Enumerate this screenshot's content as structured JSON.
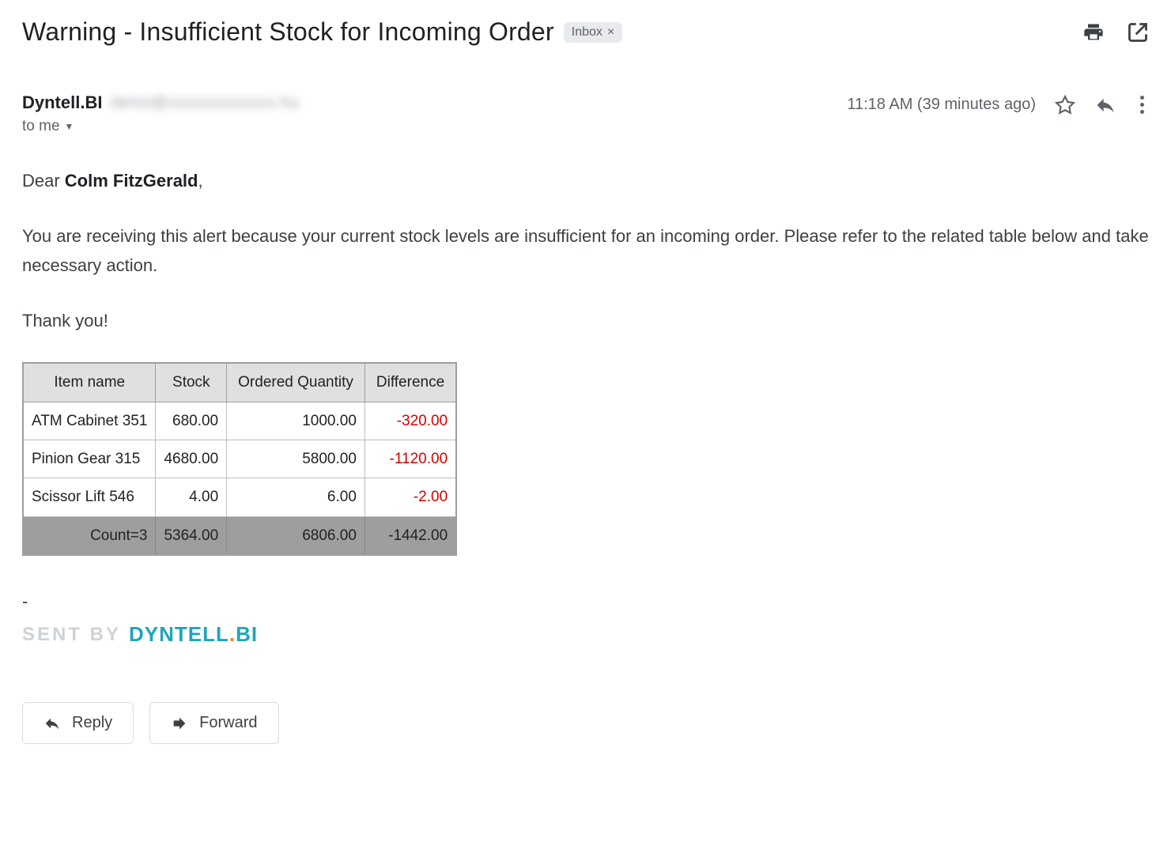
{
  "header": {
    "subject": "Warning - Insufficient Stock for Incoming Order",
    "inbox_label": "Inbox",
    "inbox_x": "×"
  },
  "sender": {
    "name": "Dyntell.BI",
    "to_label": "to me",
    "time": "11:18 AM (39 minutes ago)"
  },
  "body": {
    "greeting_prefix": "Dear ",
    "greeting_name": "Colm FitzGerald",
    "greeting_suffix": ",",
    "paragraph": "You are receiving this alert because your current stock levels are insufficient for an incoming order. Please refer to the related table below and take necessary action.",
    "thanks": "Thank you!"
  },
  "table": {
    "headers": [
      "Item name",
      "Stock",
      "Ordered Quantity",
      "Difference"
    ],
    "rows": [
      {
        "name": "ATM Cabinet 351",
        "stock": "680.00",
        "ordered": "1000.00",
        "diff": "-320.00"
      },
      {
        "name": "Pinion Gear 315",
        "stock": "4680.00",
        "ordered": "5800.00",
        "diff": "-1120.00"
      },
      {
        "name": "Scissor Lift 546",
        "stock": "4.00",
        "ordered": "6.00",
        "diff": "-2.00"
      }
    ],
    "footer": {
      "label": "Count=3",
      "stock": "5364.00",
      "ordered": "6806.00",
      "diff": "-1442.00"
    }
  },
  "signature": {
    "dash": "-",
    "sent_by": "SENT BY",
    "brand_main": "DYNTELL",
    "brand_dot": ".",
    "brand_tail": "Bi"
  },
  "actions": {
    "reply": "Reply",
    "forward": "Forward"
  }
}
